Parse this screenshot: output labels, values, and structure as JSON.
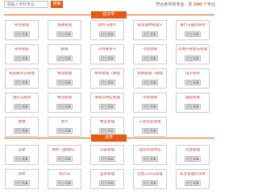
{
  "search": {
    "placeholder": "请输入专科专业",
    "button_label": "搜索",
    "result_prefix": "符合条件的专业：共",
    "result_count": "240",
    "result_suffix": "个专业"
  },
  "sections": [
    {
      "title": "经济学",
      "button_label": "招生简章",
      "majors": [
        "商务管理",
        "金融管理",
        "财务与会计",
        "投资理财管理学",
        "银行与国际商务",
        "商务经纪",
        "税收",
        "公共关系学",
        "市场营销",
        "房地产经营与管理",
        "民航服务与管理",
        "物流管理",
        "财务管理（基础",
        "营销管理（基础",
        "电子商务",
        "酒店与旅游",
        "物流管理",
        "采购与供应管理",
        "市场营销",
        "国际贸易",
        "金融",
        "会计",
        "物业管理",
        "工商企业管理"
      ]
    },
    {
      "title": "法学",
      "button_label": "招生简章",
      "majors": [
        "法律",
        "律师（基础科）",
        "公安管理",
        "监狱劳动改造",
        "社会管理",
        "律师",
        "经济法",
        "监狱管理",
        "社会工作与管理",
        "航空管理的法律"
      ]
    }
  ],
  "colors": {
    "accent": "#e55b13",
    "major_name": "#c0392b",
    "card_border": "#cccccc"
  }
}
